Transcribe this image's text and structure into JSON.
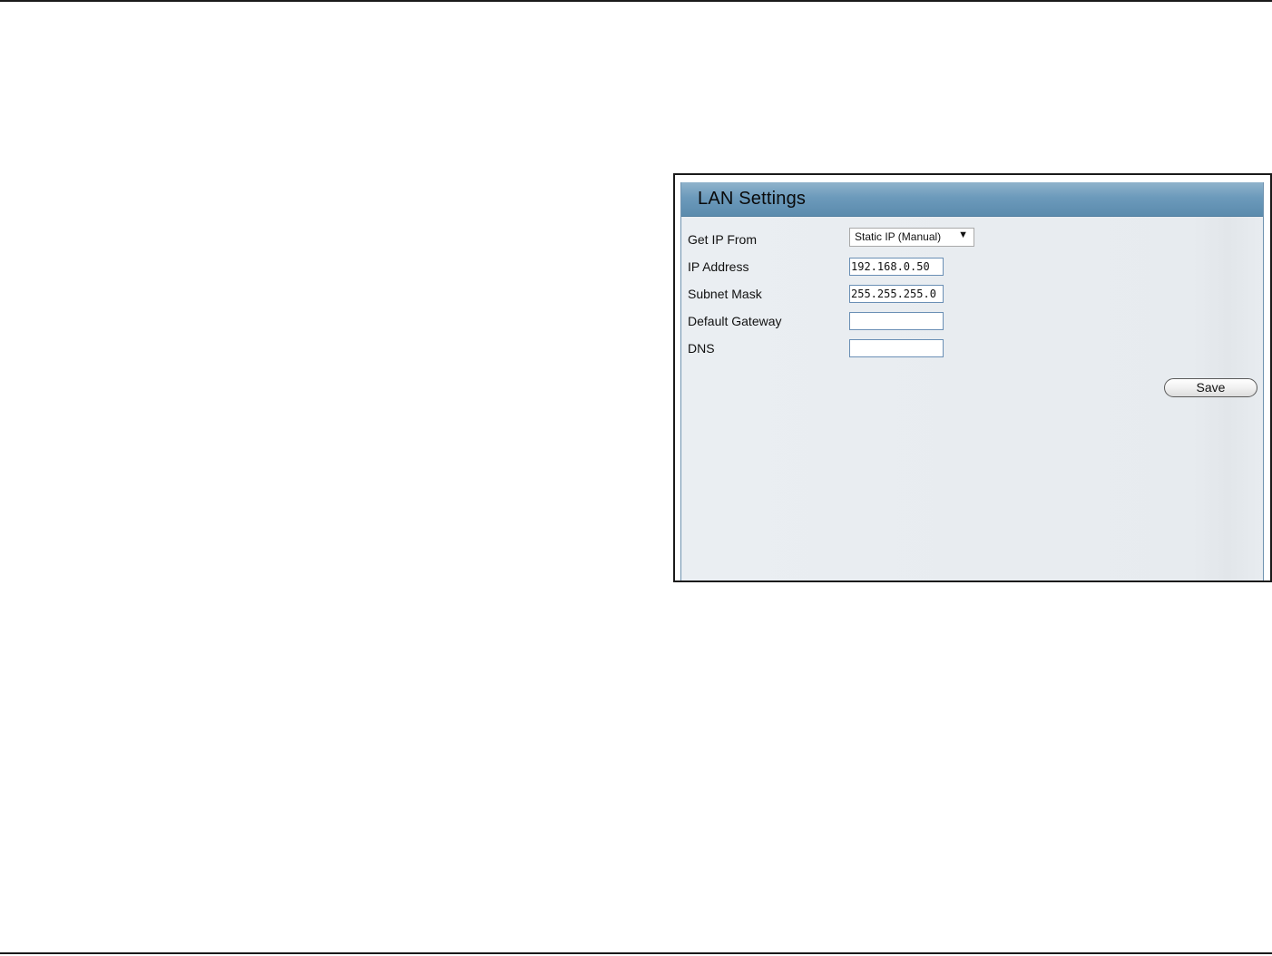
{
  "panel": {
    "title": "LAN Settings"
  },
  "form": {
    "get_ip_from": {
      "label": "Get IP From",
      "selected": "Static IP (Manual)"
    },
    "ip_address": {
      "label": "IP Address",
      "value": "192.168.0.50"
    },
    "subnet_mask": {
      "label": "Subnet Mask",
      "value": "255.255.255.0"
    },
    "default_gateway": {
      "label": "Default Gateway",
      "value": ""
    },
    "dns": {
      "label": "DNS",
      "value": ""
    }
  },
  "actions": {
    "save_label": "Save"
  },
  "icons": {
    "dropdown_arrow": "▼"
  }
}
